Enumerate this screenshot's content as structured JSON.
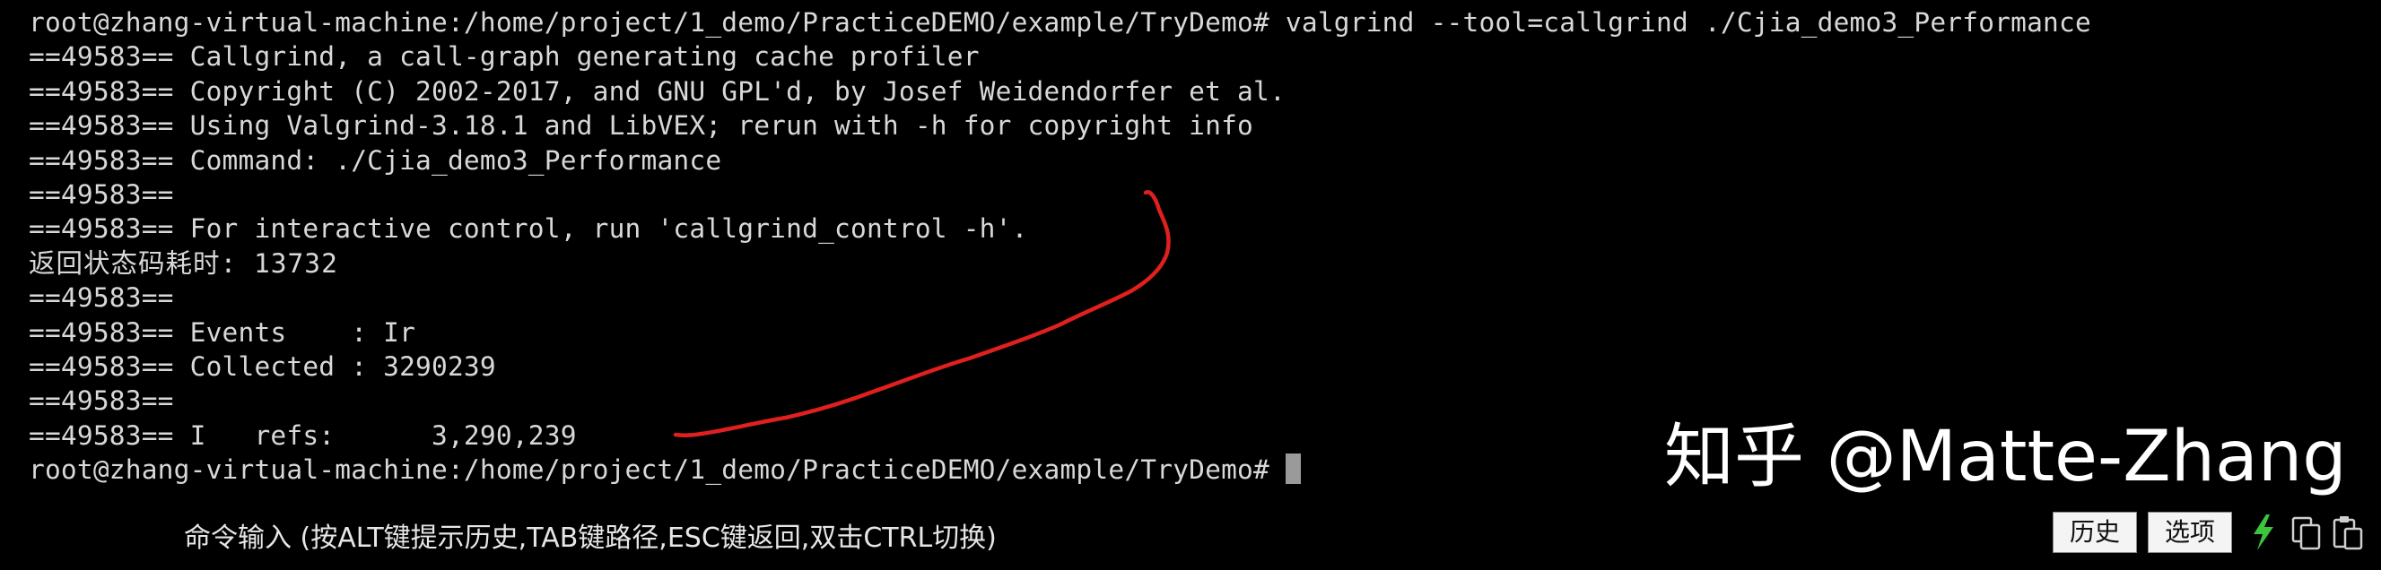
{
  "terminal": {
    "lines": [
      "root@zhang-virtual-machine:/home/project/1_demo/PracticeDEMO/example/TryDemo# valgrind --tool=callgrind ./Cjia_demo3_Performance",
      "==49583== Callgrind, a call-graph generating cache profiler",
      "==49583== Copyright (C) 2002-2017, and GNU GPL'd, by Josef Weidendorfer et al.",
      "==49583== Using Valgrind-3.18.1 and LibVEX; rerun with -h for copyright info",
      "==49583== Command: ./Cjia_demo3_Performance",
      "==49583==",
      "==49583== For interactive control, run 'callgrind_control -h'.",
      "返回状态码耗时: 13732",
      "==49583==",
      "==49583== Events    : Ir",
      "==49583== Collected : 3290239",
      "==49583==",
      "==49583== I   refs:      3,290,239"
    ],
    "prompt": "root@zhang-virtual-machine:/home/project/1_demo/PracticeDEMO/example/TryDemo#"
  },
  "watermark": "知乎 @Matte-Zhang",
  "statusbar": {
    "command_hint": "命令输入 (按ALT键提示历史,TAB键路径,ESC键返回,双击CTRL切换)",
    "history_button": "历史",
    "options_button": "选项",
    "icons": [
      "lightning-icon",
      "copy-icon",
      "paste-icon"
    ]
  },
  "colors": {
    "background": "#000000",
    "text": "#d8d8d8",
    "annotation": "#e0201e",
    "lightning": "#3cc43c"
  }
}
